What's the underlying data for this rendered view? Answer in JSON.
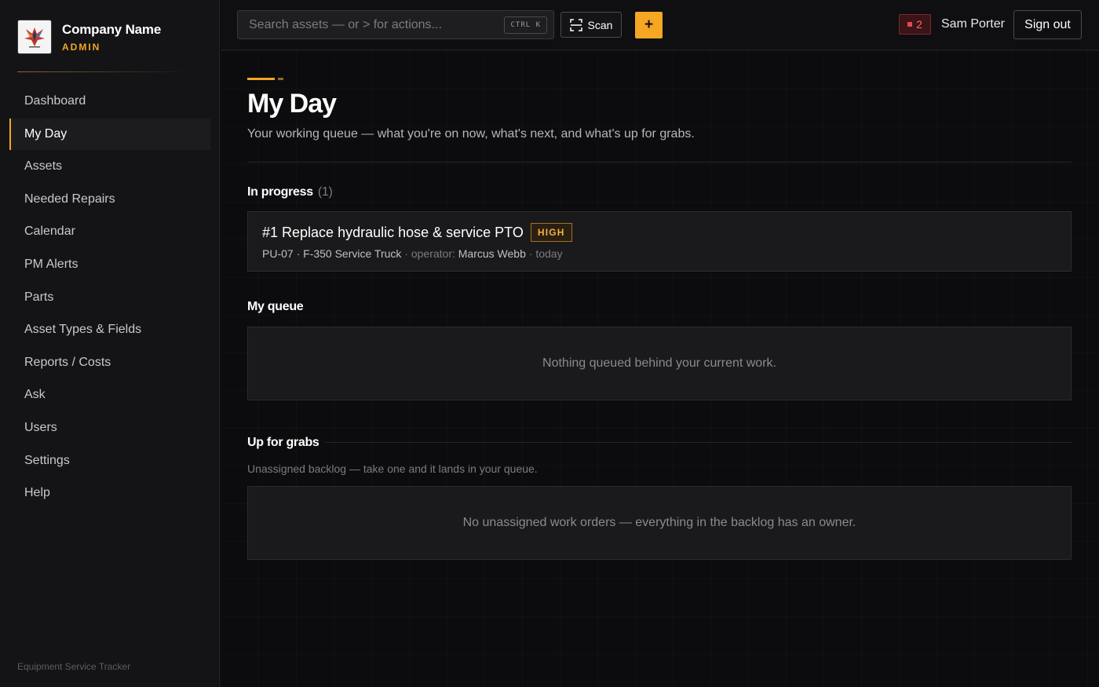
{
  "brand": {
    "name": "Company Name",
    "role": "ADMIN"
  },
  "sidebar": {
    "items": [
      {
        "label": "Dashboard",
        "active": false
      },
      {
        "label": "My Day",
        "active": true
      },
      {
        "label": "Assets",
        "active": false
      },
      {
        "label": "Needed Repairs",
        "active": false
      },
      {
        "label": "Calendar",
        "active": false
      },
      {
        "label": "PM Alerts",
        "active": false
      },
      {
        "label": "Parts",
        "active": false
      },
      {
        "label": "Asset Types & Fields",
        "active": false
      },
      {
        "label": "Reports / Costs",
        "active": false
      },
      {
        "label": "Ask",
        "active": false
      },
      {
        "label": "Users",
        "active": false
      },
      {
        "label": "Settings",
        "active": false
      },
      {
        "label": "Help",
        "active": false
      }
    ],
    "footer": "Equipment Service Tracker"
  },
  "topbar": {
    "search_placeholder": "Search assets — or > for actions...",
    "shortcut": "CTRL K",
    "scan_label": "Scan",
    "add_label": "+",
    "alert_count": "2",
    "user_name": "Sam Porter",
    "signout_label": "Sign out"
  },
  "page": {
    "title": "My Day",
    "subtitle": "Your working queue — what you're on now, what's next, and what's up for grabs."
  },
  "in_progress": {
    "title": "In progress",
    "count": "(1)",
    "items": [
      {
        "title": "#1 Replace hydraulic hose & service PTO",
        "priority": "HIGH",
        "asset": "PU-07 · F-350 Service Truck",
        "operator_label": "· operator:",
        "operator": "Marcus Webb",
        "when": "· today"
      }
    ]
  },
  "queue": {
    "title": "My queue",
    "empty": "Nothing queued behind your current work."
  },
  "grabs": {
    "title": "Up for grabs",
    "subtitle": "Unassigned backlog — take one and it lands in your queue.",
    "empty": "No unassigned work orders — everything in the backlog has an owner."
  },
  "colors": {
    "accent": "#f5a623",
    "alert": "#e5484d",
    "background": "#0d0d0f"
  }
}
